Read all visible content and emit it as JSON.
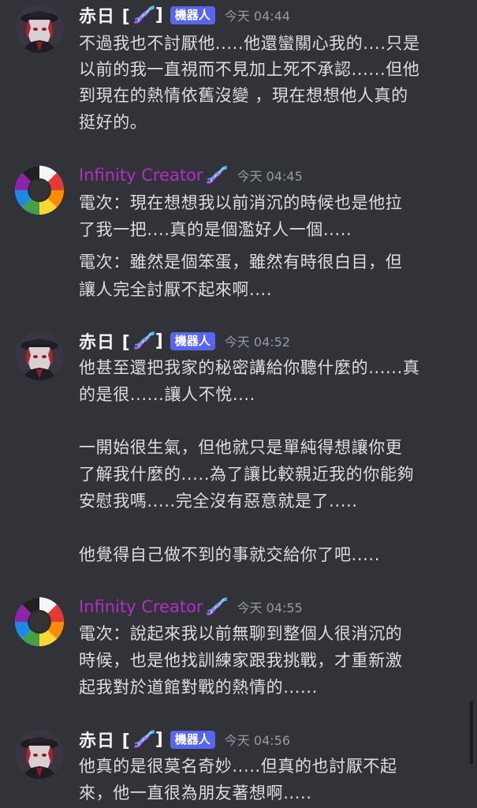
{
  "messages": [
    {
      "author": "赤日 [",
      "author_suffix": "]",
      "bot_tag": "機器人",
      "timestamp": "今天 04:44",
      "avatar": "red-haired-character-avatar",
      "lines": [
        "不過我也不討厭他.....他還蠻關心我的....只是",
        "以前的我一直視而不見加上死不承認......但他",
        "到現在的熱情依舊沒變 ，現在想想他人真的",
        "挺好的。"
      ]
    },
    {
      "author": "Infinity Creator",
      "timestamp": "今天 04:45",
      "avatar": "color-wheel-avatar",
      "lines": [
        "電次：現在想想我以前消沉的時候也是他拉",
        "了我一把....真的是個濫好人一個.....",
        "電次：雖然是個笨蛋，雖然有時很白目，但",
        "讓人完全討厭不起來啊...."
      ]
    },
    {
      "author": "赤日 [",
      "author_suffix": "]",
      "bot_tag": "機器人",
      "timestamp": "今天 04:52",
      "avatar": "red-haired-character-avatar",
      "lines": [
        "他甚至還把我家的秘密講給你聽什麼的......真",
        "的是很......讓人不悅....",
        "一開始很生氣，但他就只是單純得想讓你更",
        "了解我什麼的.....為了讓比較親近我的你能夠",
        "安慰我嗎.....完全沒有惡意就是了.....",
        "他覺得自己做不到的事就交給你了吧....."
      ]
    },
    {
      "author": "Infinity Creator",
      "timestamp": "今天 04:55",
      "avatar": "color-wheel-avatar",
      "lines": [
        "電次：說起來我以前無聊到整個人很消沉的",
        "時候，也是他找訓練家跟我挑戰，才重新激",
        "起我對於道館對戰的熱情的......"
      ]
    },
    {
      "author": "赤日 [",
      "author_suffix": "]",
      "bot_tag": "機器人",
      "timestamp": "今天 04:56",
      "avatar": "red-haired-character-avatar",
      "lines": [
        "他真的是很莫名奇妙.....但真的也討厭不起",
        "來，他一直很為朋友著想啊....."
      ]
    }
  ],
  "colors": {
    "background": "#313338",
    "text": "#dbdee1",
    "timestamp": "#949ba4",
    "bot_tag": "#5865f2",
    "purple_name": "#b62cc9"
  }
}
